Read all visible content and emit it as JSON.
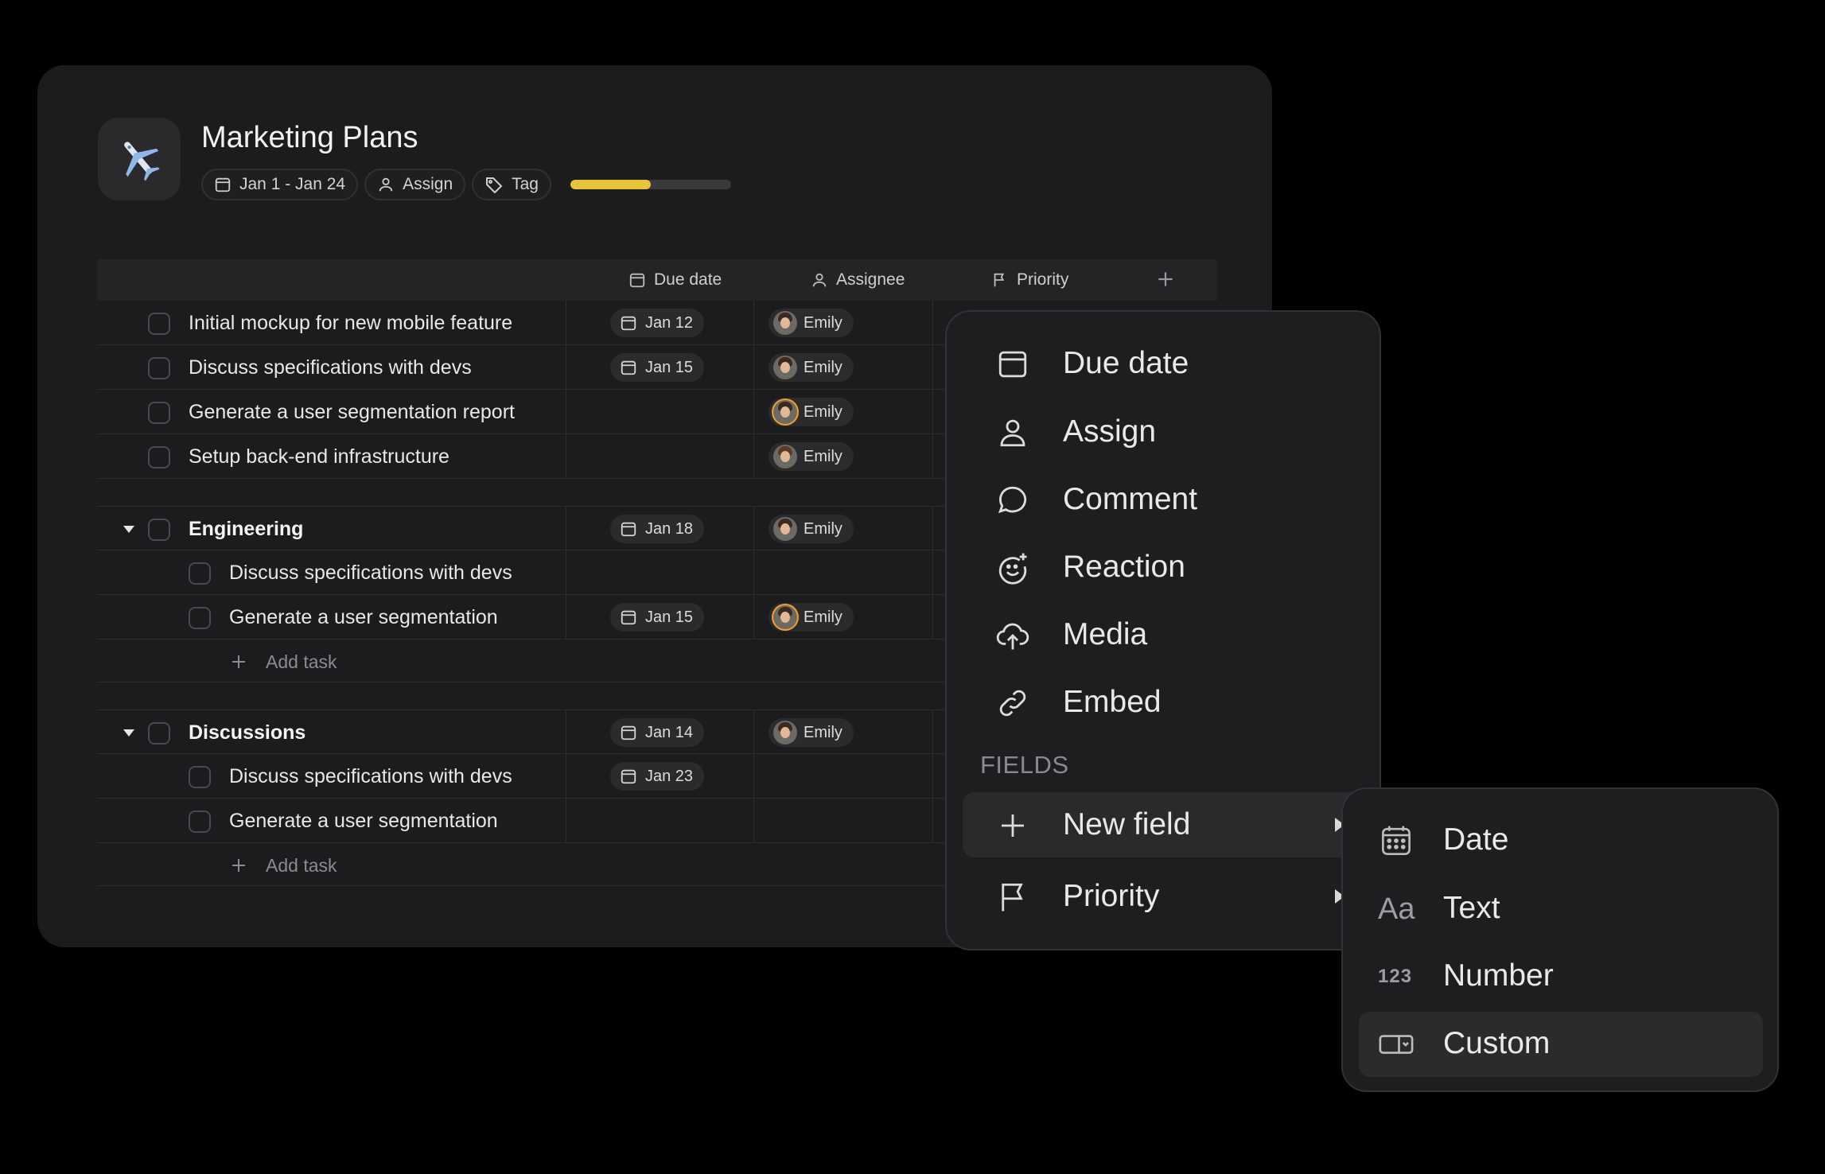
{
  "project": {
    "title": "Marketing Plans",
    "icon": "airplane-emoji",
    "date_range": "Jan 1 - Jan 24",
    "assign_label": "Assign",
    "tag_label": "Tag",
    "progress": 0.5,
    "progress_color": "#e7c33a"
  },
  "table": {
    "columns": {
      "due": "Due date",
      "assignee": "Assignee",
      "priority": "Priority"
    },
    "rows": [
      {
        "label": "Initial mockup for new mobile feature",
        "due": "Jan 12",
        "assignee": "Emily"
      },
      {
        "label": "Discuss specifications with devs",
        "due": "Jan 15",
        "assignee": "Emily"
      },
      {
        "label": "Generate a user segmentation report",
        "due": "",
        "assignee": "Emily"
      },
      {
        "label": "Setup back-end infrastructure",
        "due": "",
        "assignee": "Emily"
      }
    ],
    "groups": [
      {
        "name": "Engineering",
        "due": "Jan 18",
        "assignee": "Emily",
        "tasks": [
          {
            "label": "Discuss specifications with devs",
            "due": "",
            "assignee": ""
          },
          {
            "label": "Generate a user segmentation",
            "due": "Jan 15",
            "assignee": "Emily"
          }
        ],
        "add_task": "Add task"
      },
      {
        "name": "Discussions",
        "due": "Jan 14",
        "assignee": "Emily",
        "tasks": [
          {
            "label": "Discuss specifications with devs",
            "due": "Jan 23",
            "assignee": ""
          },
          {
            "label": "Generate a user segmentation",
            "due": "",
            "assignee": ""
          }
        ],
        "add_task": "Add task"
      }
    ]
  },
  "menu": {
    "items": [
      {
        "label": "Due date",
        "icon": "calendar-icon"
      },
      {
        "label": "Assign",
        "icon": "person-icon"
      },
      {
        "label": "Comment",
        "icon": "comment-icon"
      },
      {
        "label": "Reaction",
        "icon": "reaction-icon"
      },
      {
        "label": "Media",
        "icon": "upload-cloud-icon"
      },
      {
        "label": "Embed",
        "icon": "link-icon"
      }
    ],
    "section": "FIELDS",
    "fields": [
      {
        "label": "New field",
        "icon": "plus-icon"
      },
      {
        "label": "Priority",
        "icon": "flag-icon"
      }
    ]
  },
  "submenu": {
    "items": [
      {
        "label": "Date",
        "icon": "calendar-grid-icon"
      },
      {
        "label": "Text",
        "icon": "text-aa-icon",
        "glyph": "Aa"
      },
      {
        "label": "Number",
        "icon": "number-icon",
        "glyph": "123"
      },
      {
        "label": "Custom",
        "icon": "custom-field-icon"
      }
    ]
  }
}
